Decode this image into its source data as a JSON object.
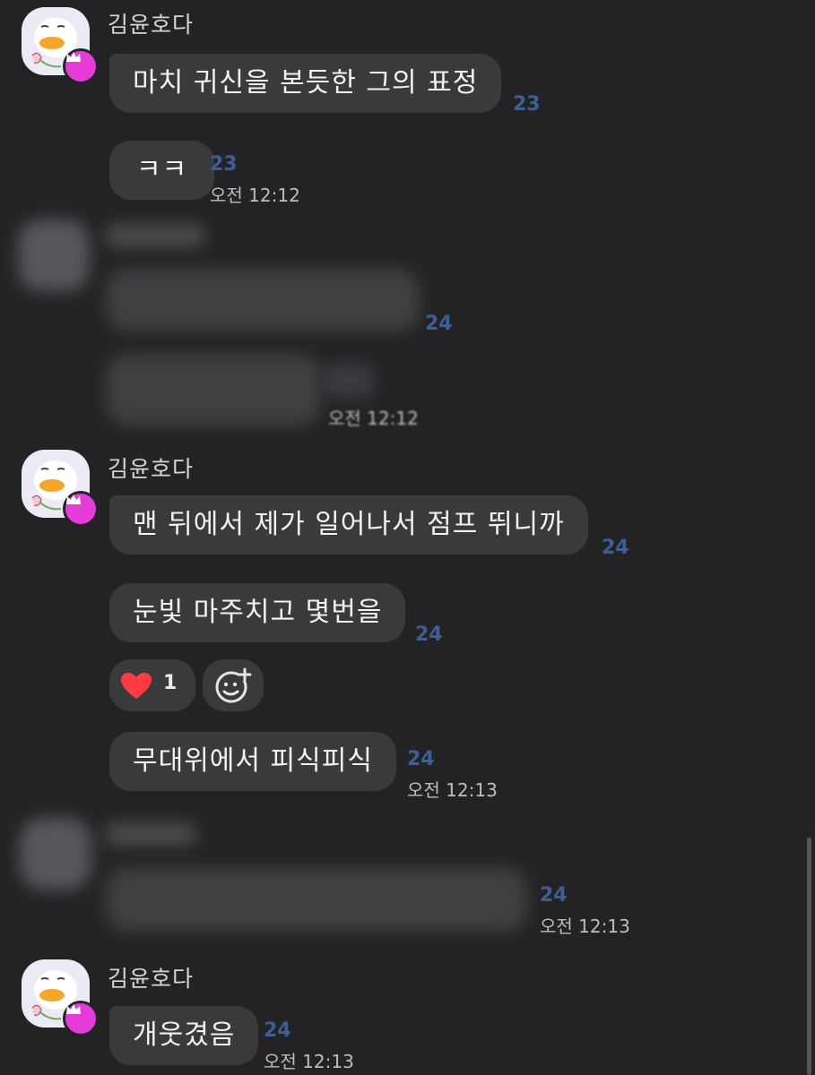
{
  "groups": [
    {
      "sender": "김윤호다",
      "messages": [
        {
          "text": "마치 귀신을 본듯한 그의 표정",
          "unread": "23",
          "time": ""
        },
        {
          "text": "ㅋㅋ",
          "unread": "23",
          "time": "오전 12:12"
        }
      ]
    },
    {
      "blurred": true,
      "messages": [
        {
          "text": "",
          "unread": "24",
          "time": ""
        },
        {
          "text": "",
          "unread": "",
          "time": "오전 12:12"
        }
      ]
    },
    {
      "sender": "김윤호다",
      "messages": [
        {
          "text": "맨 뒤에서 제가 일어나서 점프 뛰니까",
          "unread": "24",
          "time": ""
        },
        {
          "text": "눈빛 마주치고 몇번을",
          "unread": "24",
          "time": ""
        },
        {
          "text": "무대위에서 피식피식",
          "unread": "24",
          "time": "오전 12:13"
        }
      ],
      "reaction": {
        "emoji": "heart-icon",
        "count": "1"
      }
    },
    {
      "blurred": true,
      "messages": [
        {
          "text": "",
          "unread": "24",
          "time": "오전 12:13"
        }
      ]
    },
    {
      "sender": "김윤호다",
      "messages": [
        {
          "text": "개웃겼음",
          "unread": "24",
          "time": "오전 12:13"
        }
      ]
    }
  ],
  "colors": {
    "background": "#232325",
    "bubble": "#3a3a3c",
    "unread": "#3d5f96",
    "crown_badge": "#e43bd9",
    "heart": "#ff3b41"
  }
}
